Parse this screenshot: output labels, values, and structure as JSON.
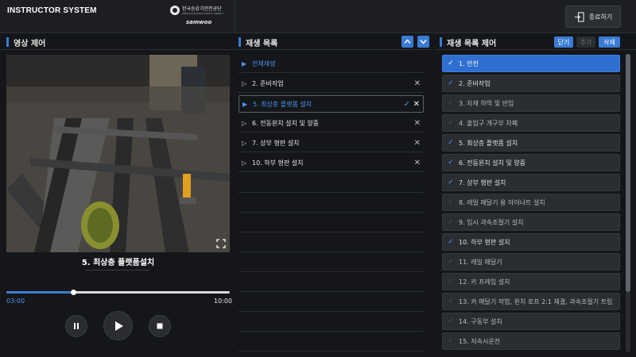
{
  "header": {
    "app_title": "INSTRUCTOR SYSTEM",
    "logo_org": "한국승강기안전공단",
    "logo_org_sub": "KOREA ELEVATOR SAFETY AGENCY",
    "logo_company": "samwoo",
    "exit_label": "종료하기"
  },
  "video_panel": {
    "title": "영상 제어",
    "current_title": "5. 최상층 플랫폼설치",
    "current_time": "03:00",
    "total_time": "10:00",
    "progress": 0.3
  },
  "playlist": {
    "title": "재생 목록",
    "play_all": "전체재생",
    "items": [
      {
        "label": "2. 준비작업",
        "active": false
      },
      {
        "label": "5. 최상층 플랫폼 설치",
        "active": true
      },
      {
        "label": "6. 전동윈치 설치 및 양중",
        "active": false
      },
      {
        "label": "7. 상부 형판 설치",
        "active": false
      },
      {
        "label": "10. 하부 형판 설치",
        "active": false
      }
    ]
  },
  "playlist_control": {
    "title": "재생 목록 제어",
    "close_label": "닫기",
    "add_label": "추가",
    "delete_label": "삭제",
    "items": [
      {
        "label": "1. 안전",
        "checked": false,
        "selected": true
      },
      {
        "label": "2. 준비작업",
        "checked": true,
        "selected": false
      },
      {
        "label": "3. 자재 하역 및 반입",
        "checked": false,
        "selected": false
      },
      {
        "label": "4. 출입구 개구부 차폐",
        "checked": false,
        "selected": false
      },
      {
        "label": "5. 최상층 플랫폼 설치",
        "checked": true,
        "selected": false
      },
      {
        "label": "6. 전동윈치 설치 및 양중",
        "checked": true,
        "selected": false
      },
      {
        "label": "7. 상부 형판 설치",
        "checked": true,
        "selected": false
      },
      {
        "label": "8. 레일 매달기 용 아이너트 설치",
        "checked": false,
        "selected": false
      },
      {
        "label": "9. 임시 과속조절기 설치",
        "checked": false,
        "selected": false
      },
      {
        "label": "10. 하부 형판 설치",
        "checked": true,
        "selected": false
      },
      {
        "label": "11. 레일 매달기",
        "checked": false,
        "selected": false
      },
      {
        "label": "12. 카 프레임 설치",
        "checked": false,
        "selected": false
      },
      {
        "label": "13. 카 매달기 작업, 윈치 로프 2:1 체결, 과속조절기 트립",
        "checked": false,
        "selected": false
      },
      {
        "label": "14. 구동부 설치",
        "checked": false,
        "selected": false
      },
      {
        "label": "15. 저속시운전",
        "checked": false,
        "selected": false
      }
    ]
  },
  "colors": {
    "accent": "#3a7bd5",
    "background": "#141619",
    "row_bg": "#2a2d31",
    "active_text": "#4d94f0"
  }
}
